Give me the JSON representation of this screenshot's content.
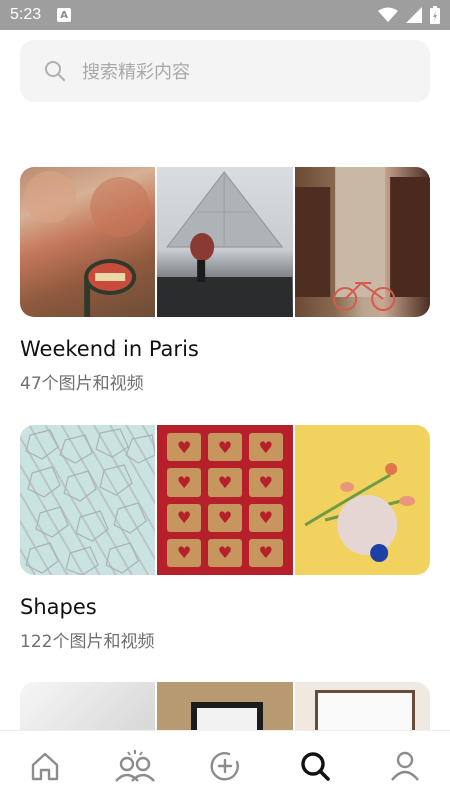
{
  "status_bar": {
    "time": "5:23",
    "notif_letter": "A"
  },
  "search": {
    "placeholder": "搜索精彩内容"
  },
  "collections": [
    {
      "title": "Weekend in Paris",
      "subtitle": "47个图片和视频"
    },
    {
      "title": "Shapes",
      "subtitle": "122个图片和视频"
    }
  ],
  "icons": {
    "search": "search-icon",
    "home": "home-icon",
    "community": "people-icon",
    "add": "add-circle-icon",
    "explore": "search-icon",
    "profile": "person-icon"
  },
  "colors": {
    "accent": "#111111",
    "inactive_icon": "#8c8c8c",
    "subtitle": "#6f6f6f"
  }
}
